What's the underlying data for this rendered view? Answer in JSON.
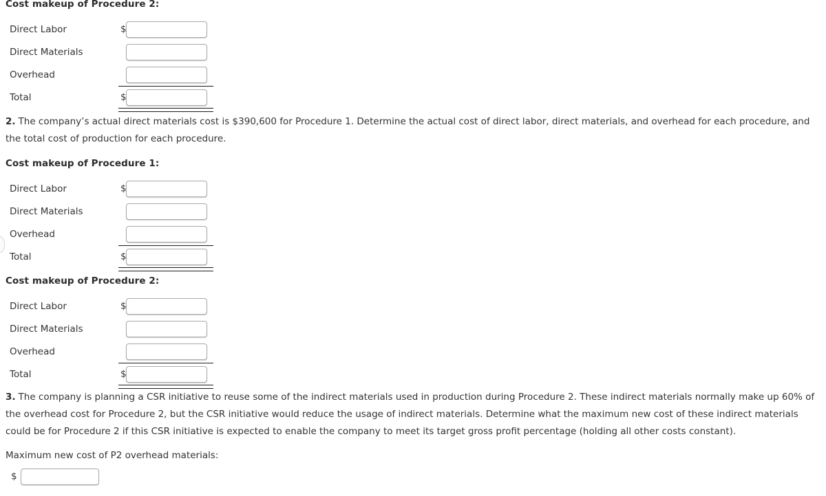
{
  "sections": {
    "top_block": {
      "heading": "Cost makeup of Procedure 2:",
      "rows": [
        {
          "label": "Direct Labor",
          "prefix": "$",
          "value": ""
        },
        {
          "label": "Direct Materials",
          "prefix": "",
          "value": ""
        },
        {
          "label": "Overhead",
          "prefix": "",
          "value": ""
        },
        {
          "label": "Total",
          "prefix": "$",
          "value": ""
        }
      ]
    },
    "question2": {
      "number": "2.",
      "text": "The company’s actual direct materials cost is $390,600 for Procedure 1. Determine the actual cost of direct labor, direct materials, and overhead for each procedure, and the total cost of production for each procedure."
    },
    "p1_block": {
      "heading": "Cost makeup of Procedure 1:",
      "rows": [
        {
          "label": "Direct Labor",
          "prefix": "$",
          "value": ""
        },
        {
          "label": "Direct Materials",
          "prefix": "",
          "value": ""
        },
        {
          "label": "Overhead",
          "prefix": "",
          "value": ""
        },
        {
          "label": "Total",
          "prefix": "$",
          "value": ""
        }
      ]
    },
    "p2_block": {
      "heading": "Cost makeup of Procedure 2:",
      "rows": [
        {
          "label": "Direct Labor",
          "prefix": "$",
          "value": ""
        },
        {
          "label": "Direct Materials",
          "prefix": "",
          "value": ""
        },
        {
          "label": "Overhead",
          "prefix": "",
          "value": ""
        },
        {
          "label": "Total",
          "prefix": "$",
          "value": ""
        }
      ]
    },
    "question3": {
      "number": "3.",
      "text": "The company is planning a CSR initiative to reuse some of the indirect materials used in production during Procedure 2. These indirect materials normally make up 60% of the overhead cost for Procedure 2, but the CSR initiative would reduce the usage of indirect materials. Determine what the maximum new cost of these indirect materials could be for Procedure 2 if this CSR initiative is expected to enable the company to meet its target gross profit percentage (holding all other costs constant)."
    },
    "final_answer": {
      "label": "Maximum new cost of P2 overhead materials:",
      "prefix": "$",
      "value": ""
    }
  },
  "colors": {
    "text": "#333333",
    "heading": "#2b2b2b",
    "rule": "#1a1a1a",
    "input_border": "#a8a8a8",
    "background": "#ffffff"
  }
}
